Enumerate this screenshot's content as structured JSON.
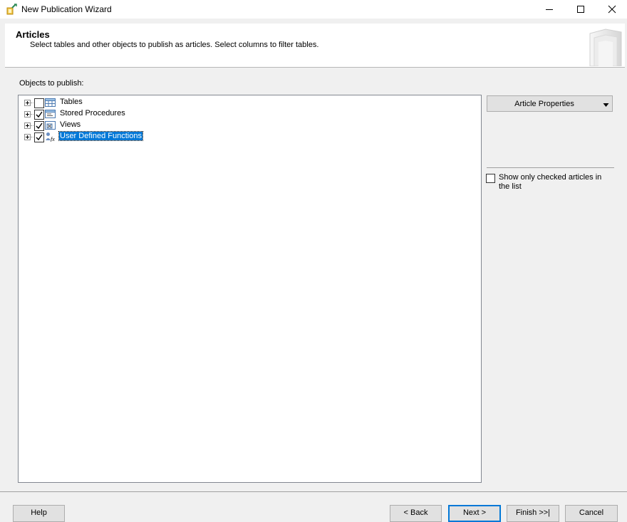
{
  "window": {
    "title": "New Publication Wizard",
    "icons": [
      "wizard-icon",
      "minimize-icon",
      "maximize-icon",
      "close-icon"
    ]
  },
  "header": {
    "title": "Articles",
    "subtitle": "Select tables and other objects to publish as articles. Select columns to filter tables."
  },
  "objects": {
    "label": "Objects to publish:",
    "items": [
      {
        "label": "Tables",
        "checked": false,
        "icon": "table-icon"
      },
      {
        "label": "Stored Procedures",
        "checked": true,
        "icon": "stored-procedure-icon"
      },
      {
        "label": "Views",
        "checked": true,
        "icon": "view-icon"
      },
      {
        "label": "User Defined Functions",
        "checked": true,
        "icon": "function-icon",
        "selected": true
      }
    ]
  },
  "side": {
    "article_properties": "Article Properties",
    "show_checked_label": "Show only checked articles in the list",
    "show_checked": false
  },
  "footer": {
    "help": "Help",
    "back": "< Back",
    "next": "Next >",
    "finish": "Finish >>|",
    "cancel": "Cancel"
  },
  "colors": {
    "selection": "#0078d7",
    "dialog_bg": "#f0f0f0",
    "button_bg": "#e1e1e1"
  }
}
